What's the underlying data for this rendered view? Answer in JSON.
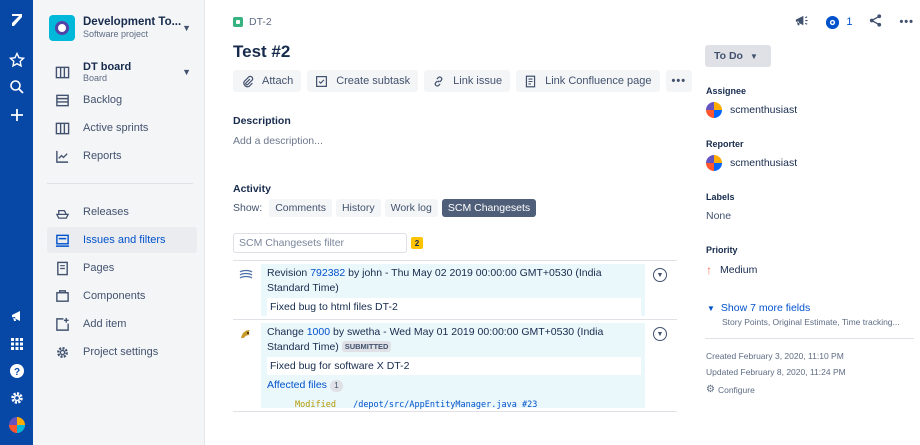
{
  "project": {
    "name": "Development To...",
    "type": "Software project"
  },
  "sidebar": {
    "board": {
      "label": "DT board",
      "sub": "Board"
    },
    "items": [
      {
        "label": "Backlog",
        "icon": "backlog-icon"
      },
      {
        "label": "Active sprints",
        "icon": "columns-icon"
      },
      {
        "label": "Reports",
        "icon": "chart-icon"
      },
      {
        "label": "Releases",
        "icon": "ship-icon"
      },
      {
        "label": "Issues and filters",
        "icon": "filter-icon"
      },
      {
        "label": "Pages",
        "icon": "page-icon"
      },
      {
        "label": "Components",
        "icon": "component-icon"
      },
      {
        "label": "Add item",
        "icon": "add-item-icon"
      },
      {
        "label": "Project settings",
        "icon": "gear-icon"
      }
    ]
  },
  "issue": {
    "key": "DT-2",
    "title": "Test #2",
    "watch_count": "1",
    "actions": [
      "Attach",
      "Create subtask",
      "Link issue",
      "Link Confluence page"
    ],
    "description_label": "Description",
    "description_placeholder": "Add a description...",
    "activity_label": "Activity",
    "show_label": "Show:",
    "tabs": [
      "Comments",
      "History",
      "Work log",
      "SCM Changesets"
    ]
  },
  "scm": {
    "filter_placeholder": "SCM Changesets filter",
    "count": "2",
    "changesets": [
      {
        "prefix": "Revision",
        "id": "792382",
        "rest": "by john - Thu May 02 2019 00:00:00 GMT+0530 (India Standard Time)",
        "message": "Fixed bug to html files DT-2"
      },
      {
        "prefix": "Change",
        "id": "1000",
        "rest": "by swetha - Wed May 01 2019 00:00:00 GMT+0530 (India Standard Time)",
        "status": "SUBMITTED",
        "message": "Fixed bug for software X DT-2",
        "affected_label": "Affected files",
        "affected_count": "1",
        "file_action": "Modified",
        "file_path": "/depot/src/AppEntityManager.java #23"
      }
    ]
  },
  "details": {
    "status": "To Do",
    "assignee_label": "Assignee",
    "assignee": "scmenthusiast",
    "reporter_label": "Reporter",
    "reporter": "scmenthusiast",
    "labels_label": "Labels",
    "labels_value": "None",
    "priority_label": "Priority",
    "priority": "Medium",
    "more_fields": "Show 7 more fields",
    "more_fields_sub": "Story Points, Original Estimate, Time tracking...",
    "created": "Created February 3, 2020, 11:10 PM",
    "updated": "Updated February 8, 2020, 11:24 PM",
    "configure": "Configure"
  }
}
